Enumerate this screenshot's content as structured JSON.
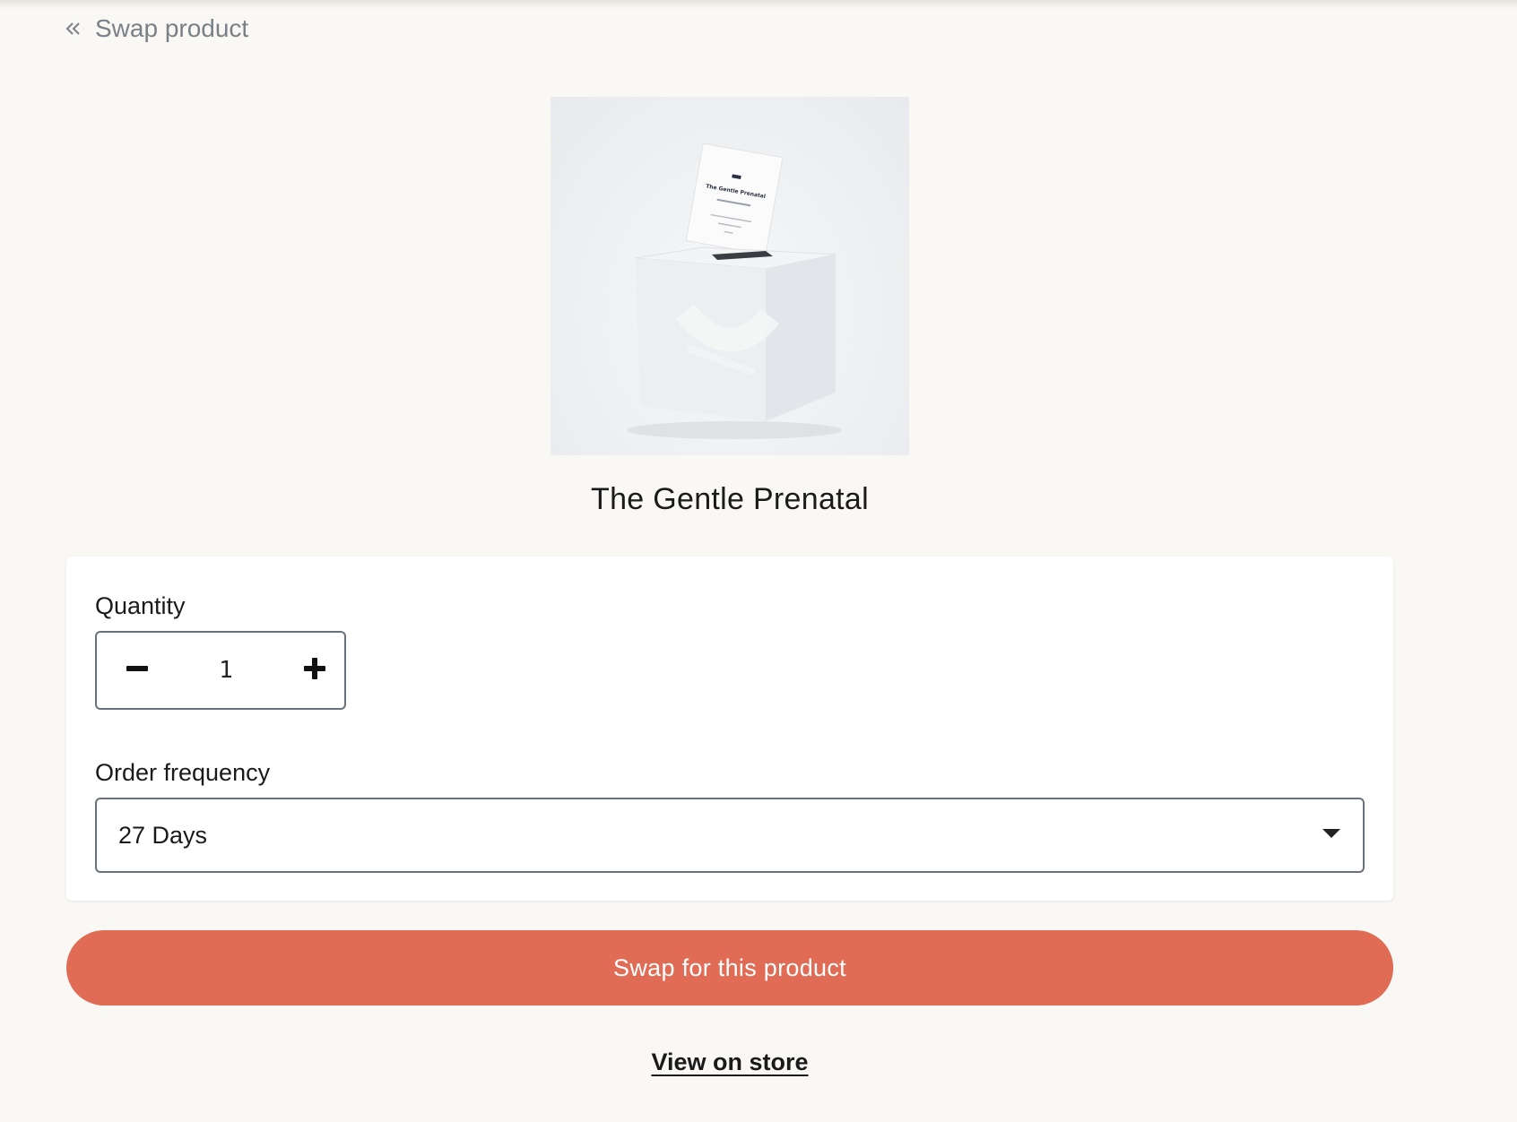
{
  "header": {
    "back_label": "Swap product",
    "back_icon": "double-chevron-left-icon"
  },
  "product": {
    "name": "The Gentle Prenatal",
    "image_alt": "The Gentle Prenatal box with sachet",
    "packet_title": "The Gentle Prenatal"
  },
  "form": {
    "quantity_label": "Quantity",
    "quantity_value": "1",
    "frequency_label": "Order frequency",
    "frequency_value": "27 Days"
  },
  "actions": {
    "swap_label": "Swap for this product",
    "store_label": "View on store"
  },
  "colors": {
    "background": "#f9f8f4",
    "accent": "#e06c56",
    "muted_text": "#7a8088",
    "border": "#6b7178"
  }
}
